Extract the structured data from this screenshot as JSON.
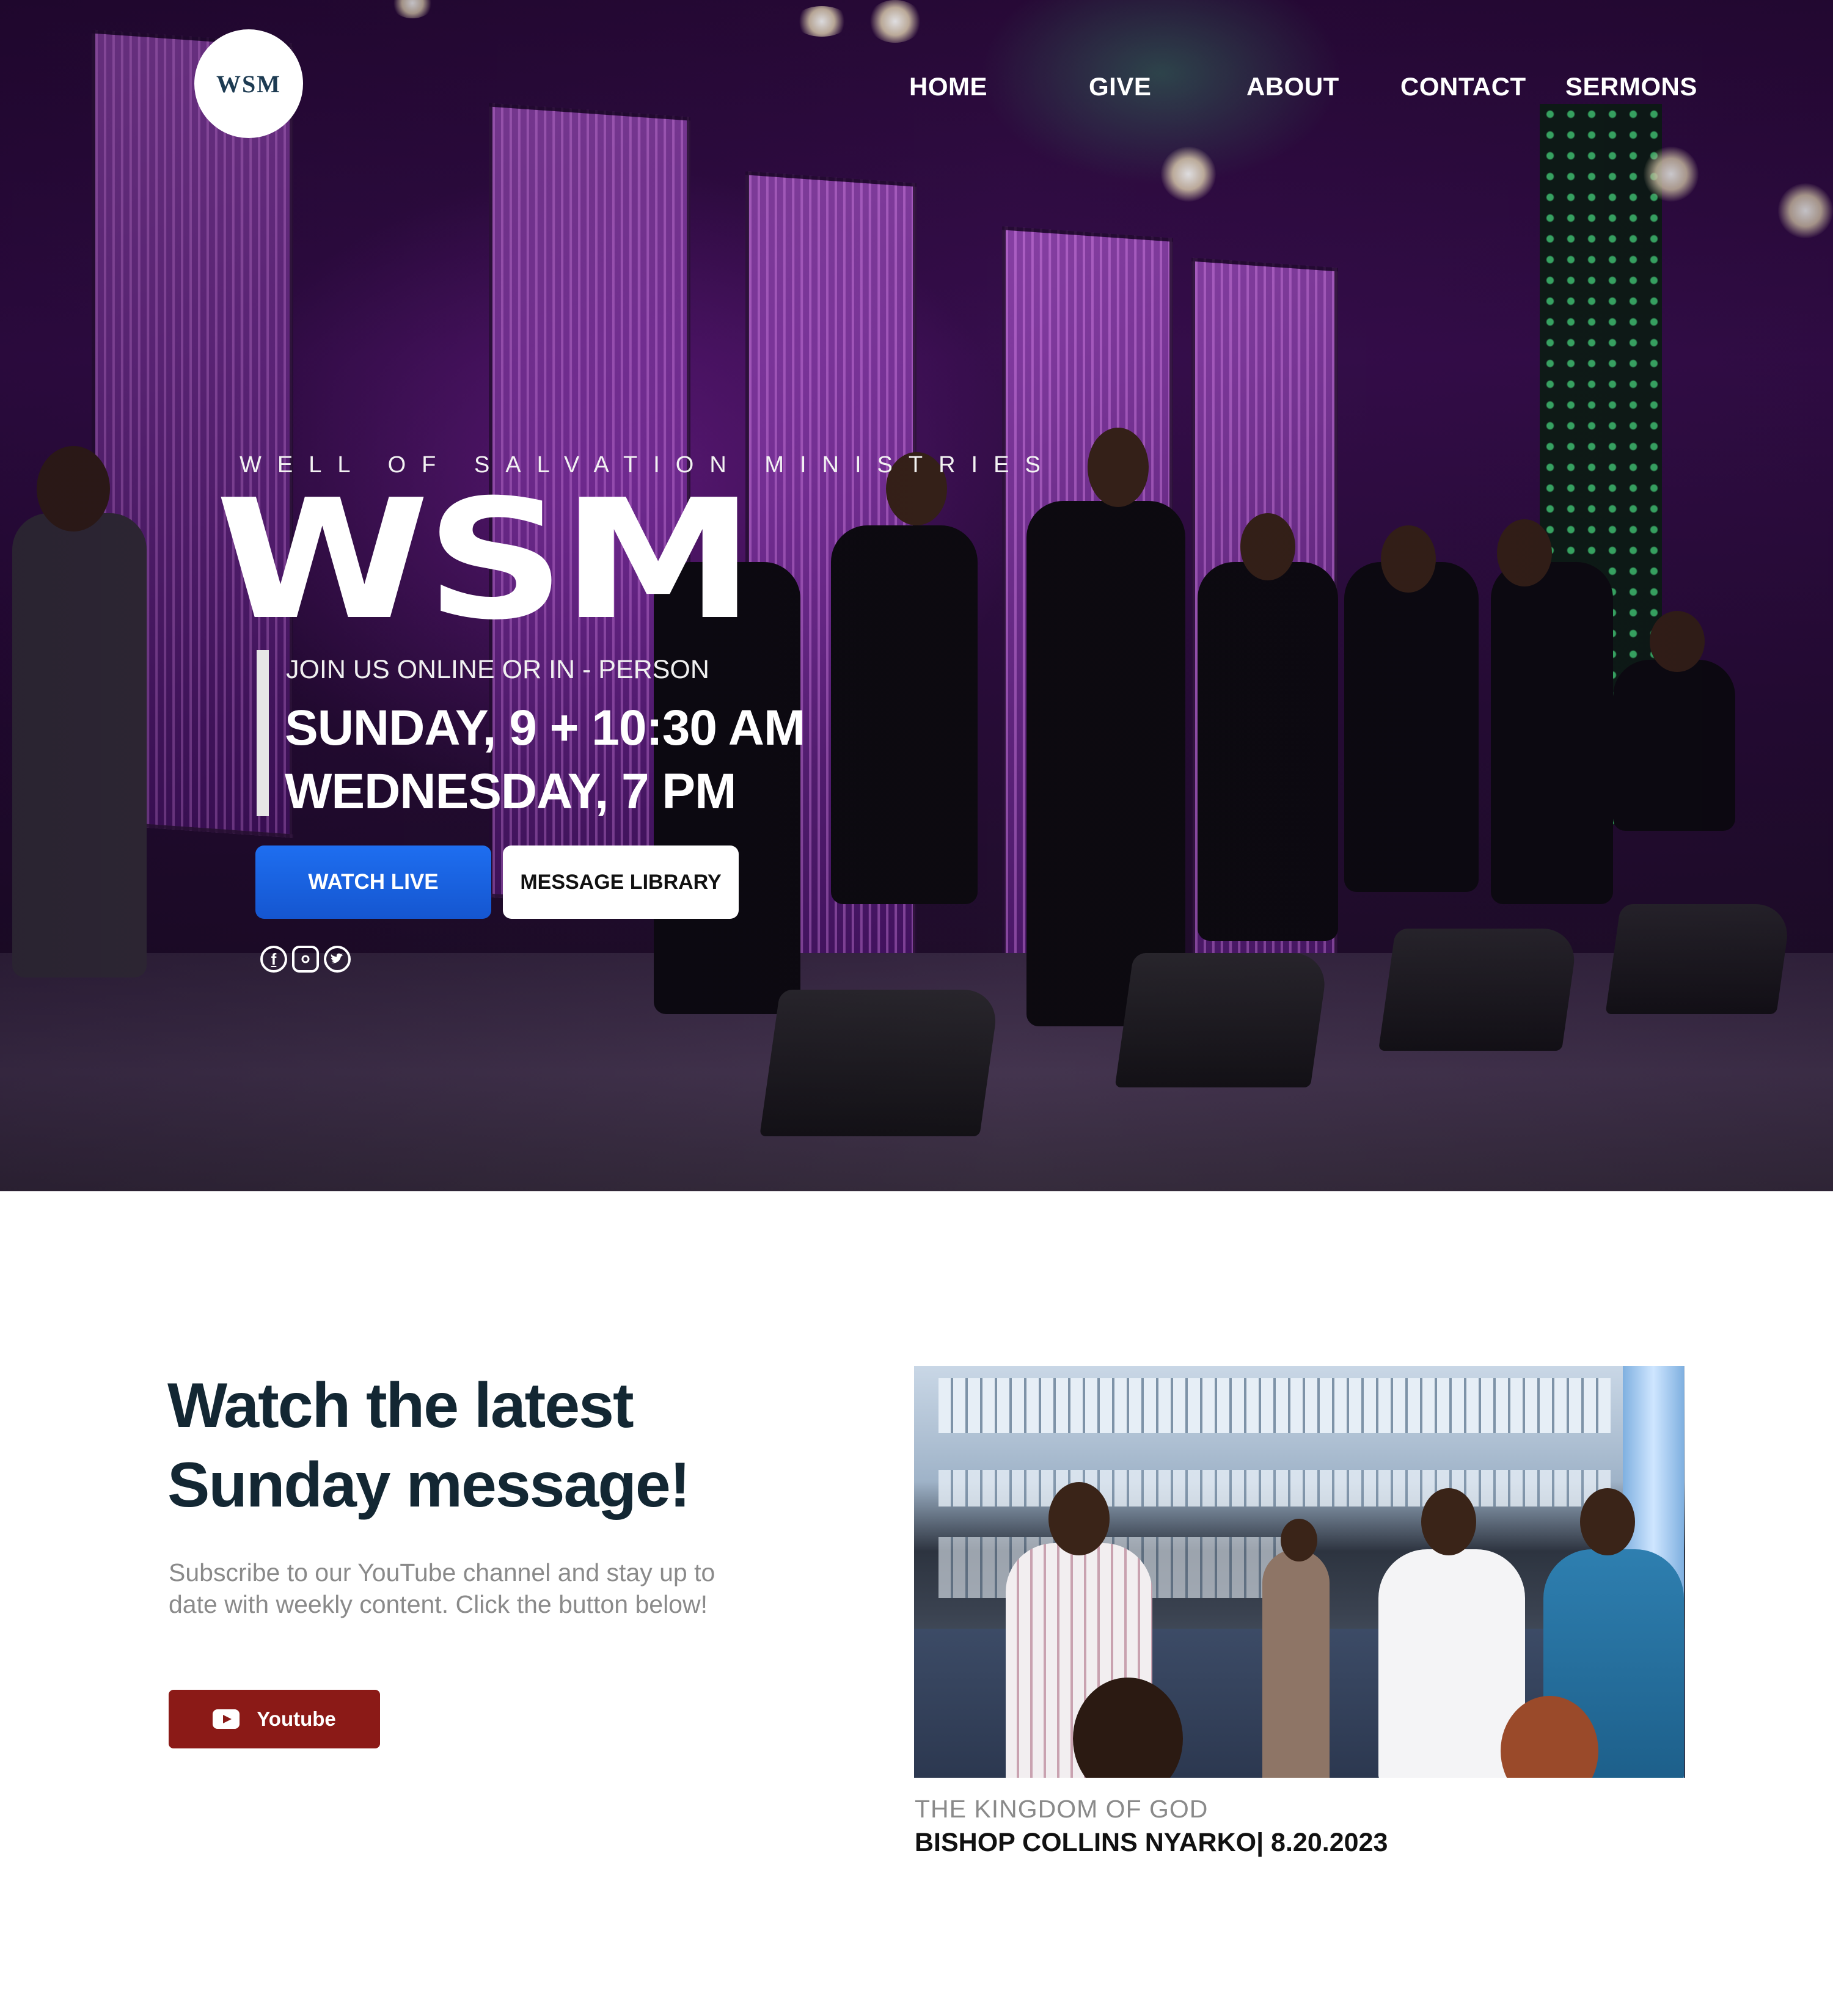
{
  "site": {
    "logo_text": "WSM"
  },
  "nav": {
    "items": [
      "HOME",
      "GIVE",
      "ABOUT",
      "CONTACT",
      "SERMONS"
    ]
  },
  "hero": {
    "ministry_name": "WELL OF SALVATION MINISTRIES",
    "brand": "WSM",
    "join_text": "JOIN US ONLINE OR IN - PERSON",
    "service_times": [
      "SUNDAY, 9 + 10:30 AM",
      "WEDNESDAY, 7 PM"
    ],
    "buttons": {
      "watch_live": "WATCH LIVE",
      "message_library": "MESSAGE LIBRARY"
    },
    "social_icons": [
      "facebook-icon",
      "instagram-icon",
      "twitter-icon"
    ],
    "accent_color": "#1e6ef0"
  },
  "latest": {
    "title": "Watch the latest Sunday message!",
    "description": "Subscribe to our YouTube channel and stay up to date with weekly content. Click the button below!",
    "youtube_button": "Youtube",
    "youtube_color": "#8b1a17",
    "sermon_title": "THE KINGDOM OF GOD",
    "sermon_meta": "BISHOP COLLINS NYARKO| 8.20.2023"
  }
}
